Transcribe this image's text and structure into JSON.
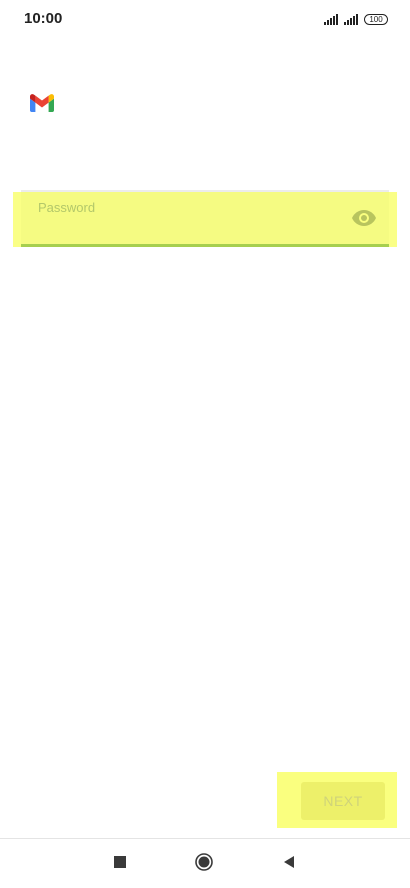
{
  "status_bar": {
    "time": "10:00",
    "battery": "100",
    "icons": [
      "signal-icon",
      "signal-icon",
      "battery-icon"
    ]
  },
  "app": {
    "logo": "gmail-logo"
  },
  "password_field": {
    "label": "Password",
    "value": "",
    "toggle_icon": "eye-icon"
  },
  "actions": {
    "next_label": "NEXT"
  },
  "navigation_bar": {
    "icons": [
      "recents-icon",
      "home-icon",
      "back-icon"
    ]
  },
  "colors": {
    "highlight": "#faff7f",
    "field_underline": "#a6cf4f",
    "gmail_red": "#ea4335",
    "gmail_blue": "#4285f4",
    "gmail_green": "#34a853",
    "gmail_yellow": "#fbbc04"
  }
}
